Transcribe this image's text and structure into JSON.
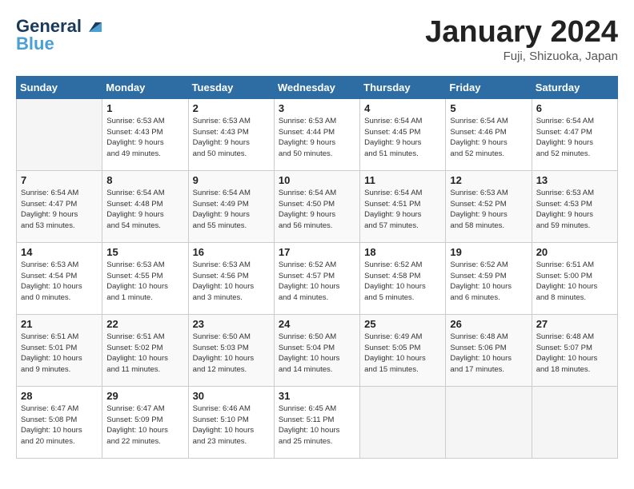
{
  "header": {
    "logo_general": "General",
    "logo_blue": "Blue",
    "month": "January 2024",
    "location": "Fuji, Shizuoka, Japan"
  },
  "weekdays": [
    "Sunday",
    "Monday",
    "Tuesday",
    "Wednesday",
    "Thursday",
    "Friday",
    "Saturday"
  ],
  "weeks": [
    [
      {
        "num": "",
        "info": ""
      },
      {
        "num": "1",
        "info": "Sunrise: 6:53 AM\nSunset: 4:43 PM\nDaylight: 9 hours\nand 49 minutes."
      },
      {
        "num": "2",
        "info": "Sunrise: 6:53 AM\nSunset: 4:43 PM\nDaylight: 9 hours\nand 50 minutes."
      },
      {
        "num": "3",
        "info": "Sunrise: 6:53 AM\nSunset: 4:44 PM\nDaylight: 9 hours\nand 50 minutes."
      },
      {
        "num": "4",
        "info": "Sunrise: 6:54 AM\nSunset: 4:45 PM\nDaylight: 9 hours\nand 51 minutes."
      },
      {
        "num": "5",
        "info": "Sunrise: 6:54 AM\nSunset: 4:46 PM\nDaylight: 9 hours\nand 52 minutes."
      },
      {
        "num": "6",
        "info": "Sunrise: 6:54 AM\nSunset: 4:47 PM\nDaylight: 9 hours\nand 52 minutes."
      }
    ],
    [
      {
        "num": "7",
        "info": "Sunrise: 6:54 AM\nSunset: 4:47 PM\nDaylight: 9 hours\nand 53 minutes."
      },
      {
        "num": "8",
        "info": "Sunrise: 6:54 AM\nSunset: 4:48 PM\nDaylight: 9 hours\nand 54 minutes."
      },
      {
        "num": "9",
        "info": "Sunrise: 6:54 AM\nSunset: 4:49 PM\nDaylight: 9 hours\nand 55 minutes."
      },
      {
        "num": "10",
        "info": "Sunrise: 6:54 AM\nSunset: 4:50 PM\nDaylight: 9 hours\nand 56 minutes."
      },
      {
        "num": "11",
        "info": "Sunrise: 6:54 AM\nSunset: 4:51 PM\nDaylight: 9 hours\nand 57 minutes."
      },
      {
        "num": "12",
        "info": "Sunrise: 6:53 AM\nSunset: 4:52 PM\nDaylight: 9 hours\nand 58 minutes."
      },
      {
        "num": "13",
        "info": "Sunrise: 6:53 AM\nSunset: 4:53 PM\nDaylight: 9 hours\nand 59 minutes."
      }
    ],
    [
      {
        "num": "14",
        "info": "Sunrise: 6:53 AM\nSunset: 4:54 PM\nDaylight: 10 hours\nand 0 minutes."
      },
      {
        "num": "15",
        "info": "Sunrise: 6:53 AM\nSunset: 4:55 PM\nDaylight: 10 hours\nand 1 minute."
      },
      {
        "num": "16",
        "info": "Sunrise: 6:53 AM\nSunset: 4:56 PM\nDaylight: 10 hours\nand 3 minutes."
      },
      {
        "num": "17",
        "info": "Sunrise: 6:52 AM\nSunset: 4:57 PM\nDaylight: 10 hours\nand 4 minutes."
      },
      {
        "num": "18",
        "info": "Sunrise: 6:52 AM\nSunset: 4:58 PM\nDaylight: 10 hours\nand 5 minutes."
      },
      {
        "num": "19",
        "info": "Sunrise: 6:52 AM\nSunset: 4:59 PM\nDaylight: 10 hours\nand 6 minutes."
      },
      {
        "num": "20",
        "info": "Sunrise: 6:51 AM\nSunset: 5:00 PM\nDaylight: 10 hours\nand 8 minutes."
      }
    ],
    [
      {
        "num": "21",
        "info": "Sunrise: 6:51 AM\nSunset: 5:01 PM\nDaylight: 10 hours\nand 9 minutes."
      },
      {
        "num": "22",
        "info": "Sunrise: 6:51 AM\nSunset: 5:02 PM\nDaylight: 10 hours\nand 11 minutes."
      },
      {
        "num": "23",
        "info": "Sunrise: 6:50 AM\nSunset: 5:03 PM\nDaylight: 10 hours\nand 12 minutes."
      },
      {
        "num": "24",
        "info": "Sunrise: 6:50 AM\nSunset: 5:04 PM\nDaylight: 10 hours\nand 14 minutes."
      },
      {
        "num": "25",
        "info": "Sunrise: 6:49 AM\nSunset: 5:05 PM\nDaylight: 10 hours\nand 15 minutes."
      },
      {
        "num": "26",
        "info": "Sunrise: 6:48 AM\nSunset: 5:06 PM\nDaylight: 10 hours\nand 17 minutes."
      },
      {
        "num": "27",
        "info": "Sunrise: 6:48 AM\nSunset: 5:07 PM\nDaylight: 10 hours\nand 18 minutes."
      }
    ],
    [
      {
        "num": "28",
        "info": "Sunrise: 6:47 AM\nSunset: 5:08 PM\nDaylight: 10 hours\nand 20 minutes."
      },
      {
        "num": "29",
        "info": "Sunrise: 6:47 AM\nSunset: 5:09 PM\nDaylight: 10 hours\nand 22 minutes."
      },
      {
        "num": "30",
        "info": "Sunrise: 6:46 AM\nSunset: 5:10 PM\nDaylight: 10 hours\nand 23 minutes."
      },
      {
        "num": "31",
        "info": "Sunrise: 6:45 AM\nSunset: 5:11 PM\nDaylight: 10 hours\nand 25 minutes."
      },
      {
        "num": "",
        "info": ""
      },
      {
        "num": "",
        "info": ""
      },
      {
        "num": "",
        "info": ""
      }
    ]
  ]
}
